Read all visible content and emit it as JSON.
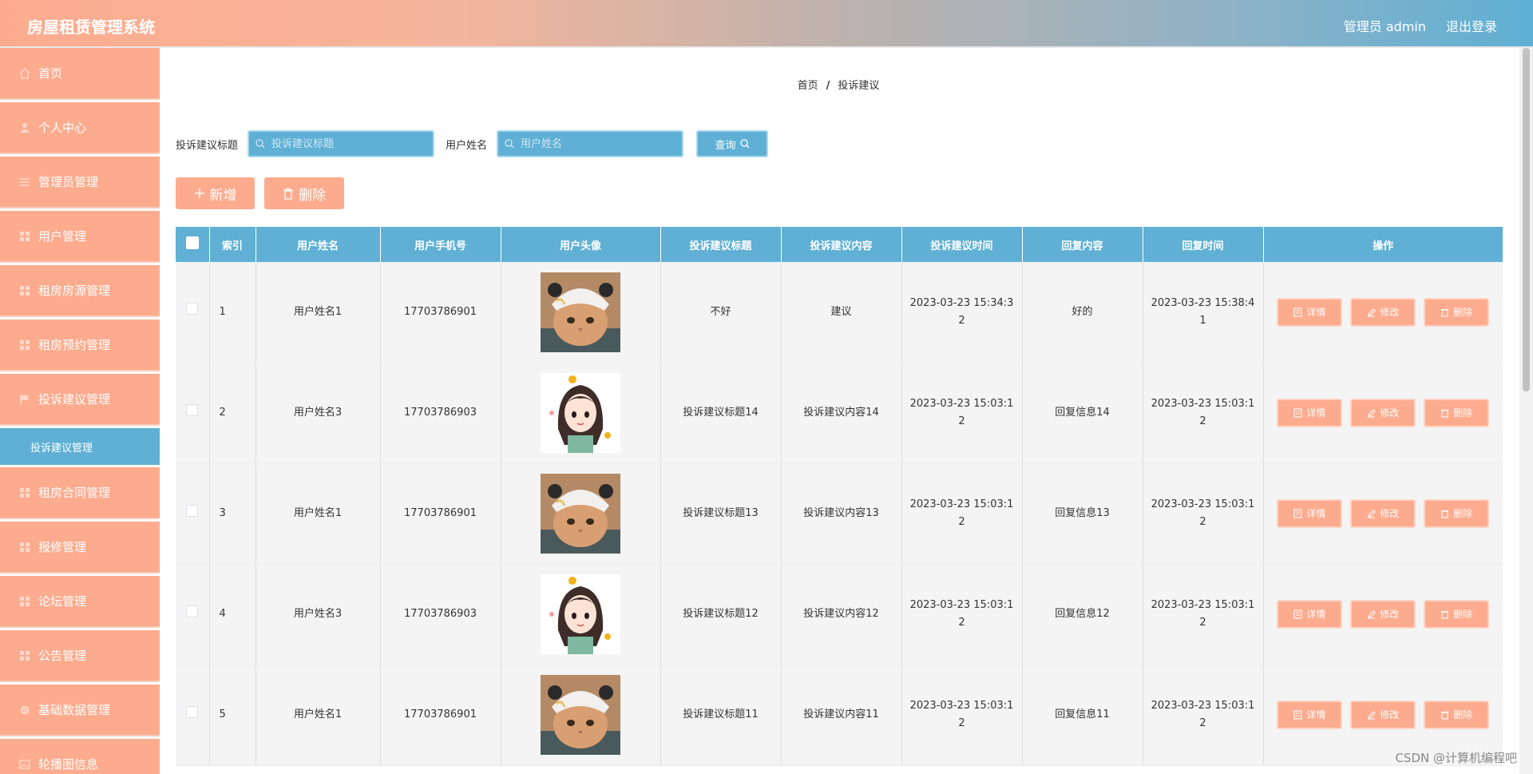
{
  "header": {
    "app_title": "房屋租赁管理系统",
    "admin_label": "管理员 admin",
    "logout_label": "退出登录"
  },
  "sidebar": {
    "items": [
      {
        "label": "首页",
        "icon": "home-icon"
      },
      {
        "label": "个人中心",
        "icon": "user-icon"
      },
      {
        "label": "管理员管理",
        "icon": "list-icon"
      },
      {
        "label": "用户管理",
        "icon": "grid-icon"
      },
      {
        "label": "租房房源管理",
        "icon": "grid-icon"
      },
      {
        "label": "租房预约管理",
        "icon": "grid-icon"
      },
      {
        "label": "投诉建议管理",
        "icon": "flag-icon"
      }
    ],
    "active_sub": "投诉建议管理",
    "items_after": [
      {
        "label": "租房合同管理",
        "icon": "grid-icon"
      },
      {
        "label": "报修管理",
        "icon": "grid-icon"
      },
      {
        "label": "论坛管理",
        "icon": "grid-icon"
      },
      {
        "label": "公告管理",
        "icon": "grid-icon"
      },
      {
        "label": "基础数据管理",
        "icon": "gear-icon"
      },
      {
        "label": "轮播图信息",
        "icon": "image-icon"
      }
    ]
  },
  "breadcrumb": {
    "home": "首页",
    "sep": "/",
    "current": "投诉建议"
  },
  "search": {
    "title_label": "投诉建议标题",
    "title_placeholder": "投诉建议标题",
    "user_label": "用户姓名",
    "user_placeholder": "用户姓名",
    "query_label": "查询"
  },
  "actions": {
    "add_label": "新增",
    "delete_label": "删除"
  },
  "table": {
    "columns": [
      "索引",
      "用户姓名",
      "用户手机号",
      "用户头像",
      "投诉建议标题",
      "投诉建议内容",
      "投诉建议时间",
      "回复内容",
      "回复时间",
      "操作"
    ],
    "rows": [
      {
        "index": "1",
        "name": "用户姓名1",
        "phone": "17703786901",
        "avatar": "cat-avatar",
        "title": "不好",
        "content": "建议",
        "time": "2023-03-23 15:34:32",
        "reply": "好的",
        "reply_time": "2023-03-23 15:38:41"
      },
      {
        "index": "2",
        "name": "用户姓名3",
        "phone": "17703786903",
        "avatar": "girl-avatar",
        "title": "投诉建议标题14",
        "content": "投诉建议内容14",
        "time": "2023-03-23 15:03:12",
        "reply": "回复信息14",
        "reply_time": "2023-03-23 15:03:12"
      },
      {
        "index": "3",
        "name": "用户姓名1",
        "phone": "17703786901",
        "avatar": "cat-avatar",
        "title": "投诉建议标题13",
        "content": "投诉建议内容13",
        "time": "2023-03-23 15:03:12",
        "reply": "回复信息13",
        "reply_time": "2023-03-23 15:03:12"
      },
      {
        "index": "4",
        "name": "用户姓名3",
        "phone": "17703786903",
        "avatar": "girl-avatar",
        "title": "投诉建议标题12",
        "content": "投诉建议内容12",
        "time": "2023-03-23 15:03:12",
        "reply": "回复信息12",
        "reply_time": "2023-03-23 15:03:12"
      },
      {
        "index": "5",
        "name": "用户姓名1",
        "phone": "17703786901",
        "avatar": "cat-avatar",
        "title": "投诉建议标题11",
        "content": "投诉建议内容11",
        "time": "2023-03-23 15:03:12",
        "reply": "回复信息11",
        "reply_time": "2023-03-23 15:03:12"
      }
    ],
    "op_labels": {
      "detail": "详情",
      "edit": "修改",
      "delete": "删除"
    }
  },
  "watermark": "CSDN @计算机编程吧",
  "colors": {
    "primary": "#fdab8e",
    "accent": "#5fb0d4"
  }
}
